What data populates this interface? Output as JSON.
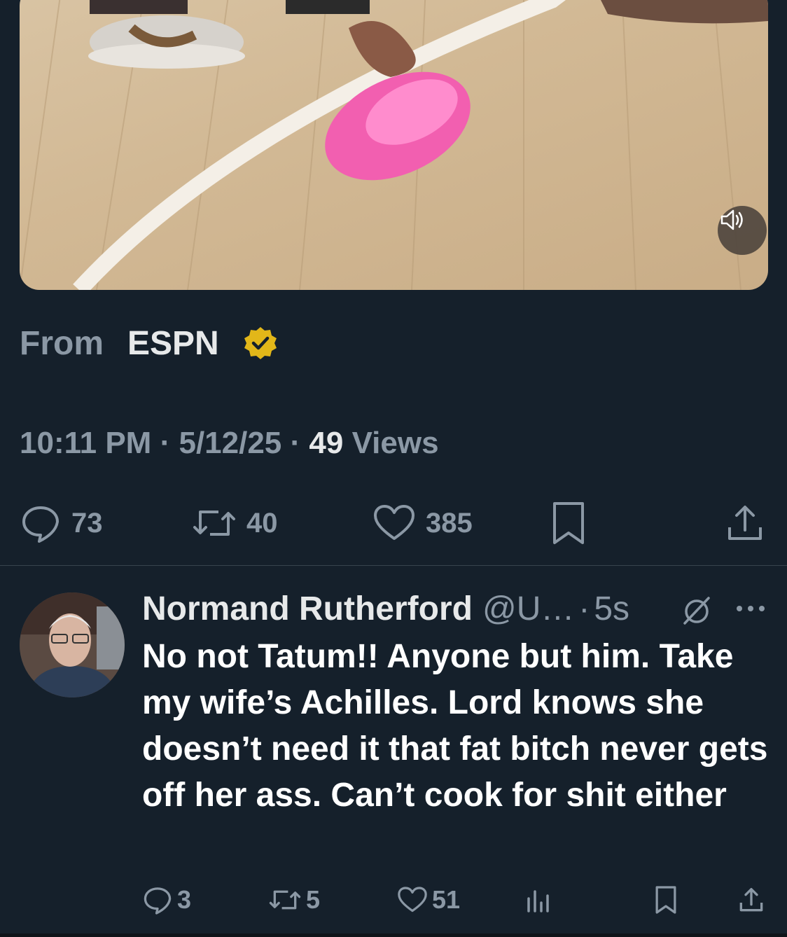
{
  "tweet": {
    "from_label": "From",
    "source_name": "ESPN",
    "time": "10:11 PM",
    "date": "5/12/25",
    "separator": "·",
    "views_count": "49",
    "views_label": "Views",
    "replies": "73",
    "reposts": "40",
    "likes": "385",
    "verified_badge_color": "#e2b719"
  },
  "reply": {
    "name": "Normand Rutherford",
    "handle": "@U…",
    "separator": "·",
    "time": "5s",
    "text": "No not Tatum!! Anyone but him. Take my wife’s Achilles. Lord knows she doesn’t need it that fat bitch never gets off her ass. Can’t cook for shit either",
    "replies": "3",
    "reposts": "5",
    "likes": "51"
  },
  "icons": {
    "mute": "speaker-icon",
    "reply": "comment-bubble-icon",
    "repost": "repost-icon",
    "like": "heart-icon",
    "bookmark": "bookmark-icon",
    "share": "share-icon",
    "analytics": "analytics-icon",
    "grok": "slashed-circle-icon",
    "more": "ellipsis-icon"
  },
  "colors": {
    "background": "#15202b",
    "primary_text": "#e7e9ea",
    "secondary_text": "#8b98a5",
    "divider": "#38444d"
  }
}
